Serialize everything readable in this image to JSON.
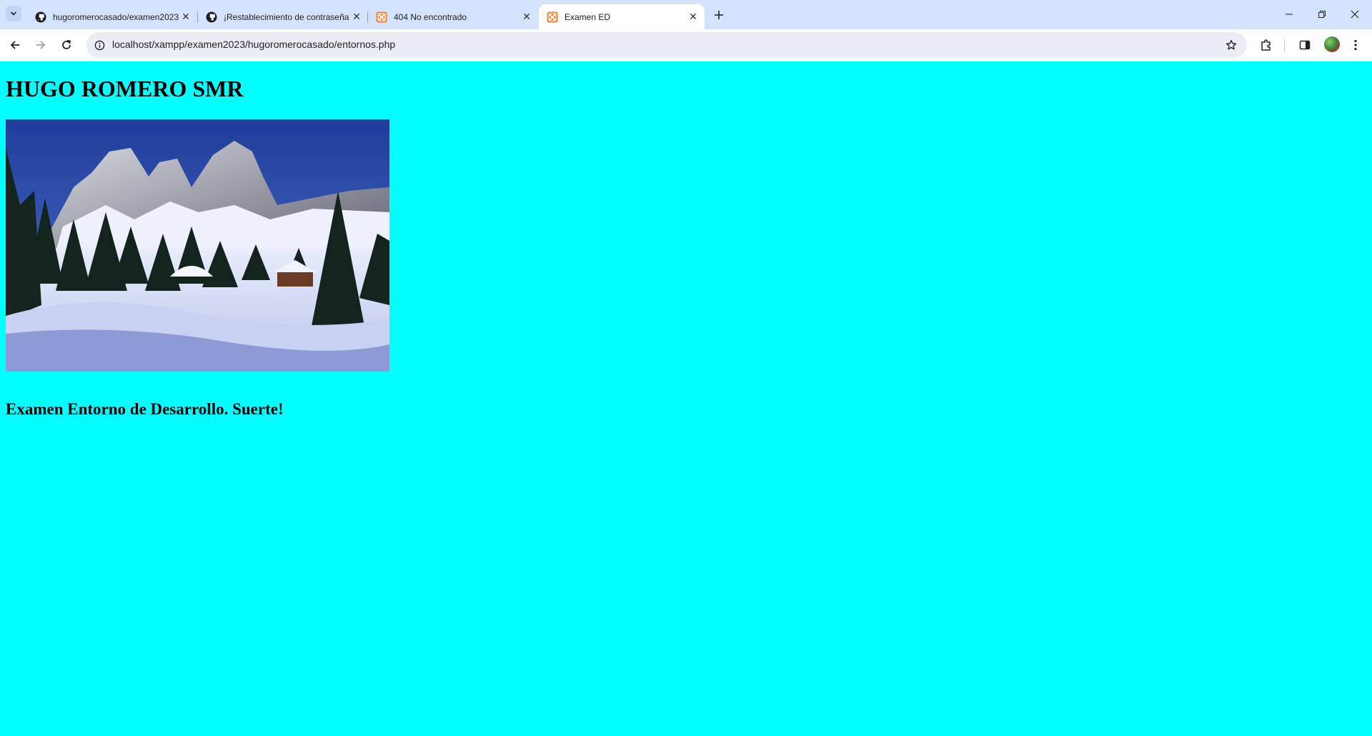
{
  "tabs": [
    {
      "title": "hugoromerocasado/examen2023",
      "favicon": "github-icon",
      "active": false
    },
    {
      "title": "¡Restablecimiento de contraseña",
      "favicon": "github-icon",
      "active": false
    },
    {
      "title": "404 No encontrado",
      "favicon": "xampp-icon",
      "active": false
    },
    {
      "title": "Examen ED",
      "favicon": "xampp-icon",
      "active": true
    }
  ],
  "address_bar": {
    "url": "localhost/xampp/examen2023/hugoromerocasado/entornos.php"
  },
  "page": {
    "heading": "HUGO ROMERO SMR",
    "image_description": "snowy mountain landscape",
    "subheading": "Examen Entorno de Desarrollo. Suerte!"
  },
  "colors": {
    "page_background": "#00ffff",
    "tabstrip": "#d3e3fd",
    "xampp_accent": "#fb7a24"
  }
}
